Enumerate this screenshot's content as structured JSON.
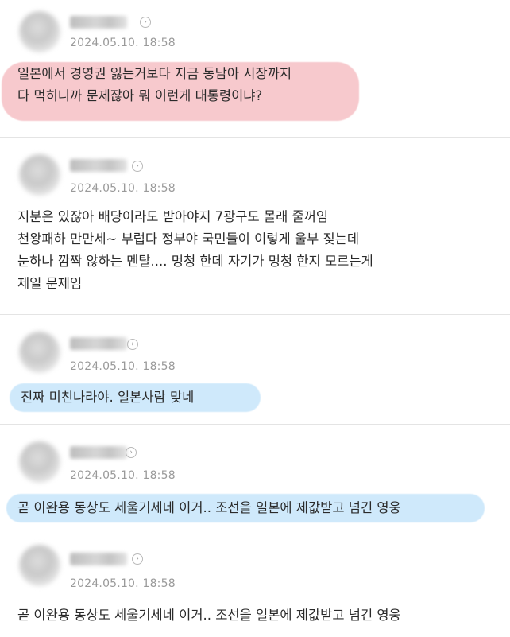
{
  "comments": [
    {
      "date": "2024.05.10. 18:58",
      "lines": [
        "일본에서 경영권 잃는거보다 지금 동남아 시장까지",
        "다 먹히니까 문제잖아 뭐 이런게 대통령이냐?"
      ],
      "highlight": "pink"
    },
    {
      "date": "2024.05.10. 18:58",
      "lines": [
        "지분은 있잖아 배당이라도 받아야지 7광구도 몰래 줄꺼임",
        "천왕패하 만만세~ 부럽다 정부야 국민들이 이렇게 울부 짖는데",
        "눈하나 깜짝 않하는 멘탈.... 멍청 한데 자기가 멍청 한지 모르는게",
        "제일 문제임"
      ],
      "highlight": "none"
    },
    {
      "date": "2024.05.10. 18:58",
      "lines": [
        "진짜 미친나라야. 일본사람 맞네"
      ],
      "highlight": "blue"
    },
    {
      "date": "2024.05.10. 18:58",
      "lines": [
        "곧 이완용 동상도 세울기세네 이거.. 조선을 일본에 제값받고 넘긴 영웅"
      ],
      "highlight": "blue"
    },
    {
      "date": "2024.05.10. 18:58",
      "lines": [
        "곧 이완용 동상도 세울기세네 이거.. 조선을 일본에 제값받고 넘긴 영웅"
      ],
      "highlight": "none"
    }
  ],
  "icons": {
    "profile_arrow": "›"
  },
  "colors": {
    "pink_highlight": "#f7c9cd",
    "blue_highlight": "#cfe9fb",
    "date_gray": "#9a9a9a"
  }
}
